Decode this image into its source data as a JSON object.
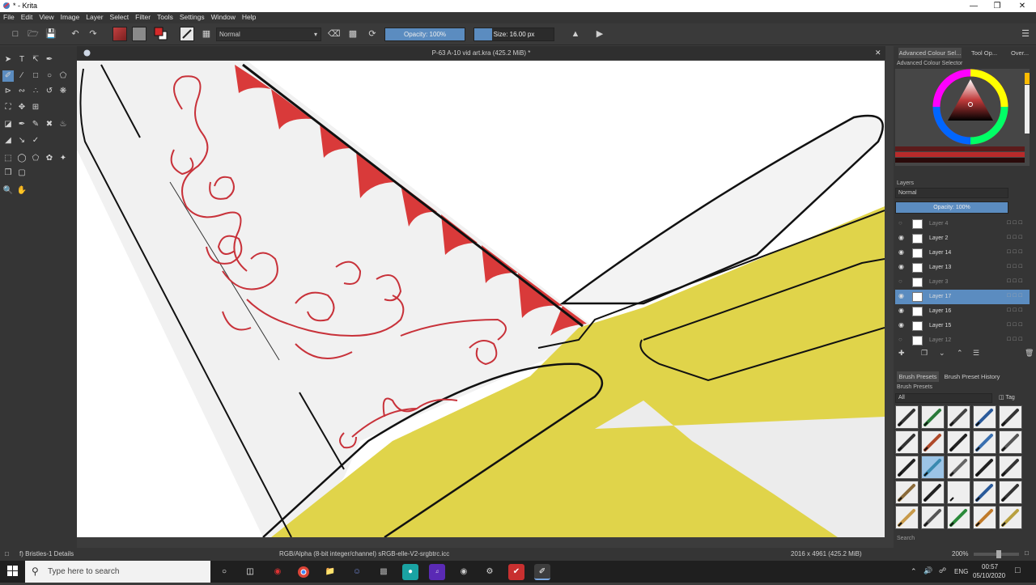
{
  "window": {
    "title": "* - Krita",
    "app_icon": "krita-icon",
    "controls": [
      "minimize-icon",
      "restore-icon",
      "close-icon"
    ]
  },
  "menu": [
    "File",
    "Edit",
    "View",
    "Image",
    "Layer",
    "Select",
    "Filter",
    "Tools",
    "Settings",
    "Window",
    "Help"
  ],
  "toolbar": {
    "blend_mode": "Normal",
    "opacity_label": "Opacity: 100%",
    "opacity_value": 1.0,
    "size_label": "Size: 16.00 px"
  },
  "document": {
    "tab_title": "P-63 A-10 vid art.kra (425.2 MiB) *"
  },
  "panels": {
    "tabs": [
      "Advanced Colour Sel...",
      "Tool Op...",
      "Over..."
    ],
    "color_selector_title": "Advanced Colour Selector",
    "layers_title": "Layers",
    "layers_blend": "Normal",
    "layers_opacity": "Opacity: 100%",
    "layers": [
      {
        "name": "Layer 4",
        "visible": false,
        "selected": false
      },
      {
        "name": "Layer 2",
        "visible": true,
        "selected": false
      },
      {
        "name": "Layer 14",
        "visible": true,
        "selected": false
      },
      {
        "name": "Layer 13",
        "visible": true,
        "selected": false
      },
      {
        "name": "Layer 3",
        "visible": false,
        "selected": false
      },
      {
        "name": "Layer 17",
        "visible": true,
        "selected": true
      },
      {
        "name": "Layer 16",
        "visible": true,
        "selected": false
      },
      {
        "name": "Layer 15",
        "visible": true,
        "selected": false
      },
      {
        "name": "Layer 12",
        "visible": false,
        "selected": false
      }
    ],
    "brush_tabs": [
      "Brush Presets",
      "Brush Preset History"
    ],
    "brush_presets_title": "Brush Presets",
    "brush_filter": "All",
    "brush_tag": "Tag",
    "brush_search": "Search"
  },
  "status": {
    "brush_details": "f) Bristles-1 Details",
    "color_profile": "RGB/Alpha (8-bit integer/channel)  sRGB-elle-V2-srgbtrc.icc",
    "image_size": "2016 x 4961 (425.2 MiB)",
    "zoom": "200%"
  },
  "taskbar": {
    "search_placeholder": "Type here to search",
    "language": "ENG",
    "time": "00:57",
    "date": "05/10/2020",
    "apps": [
      "cortana-icon",
      "task-view-icon",
      "obs-icon",
      "chrome-icon",
      "file-explorer-icon",
      "discord-icon",
      "app-icon",
      "app-icon",
      "amazon-music-icon",
      "app-icon",
      "steam-icon",
      "app-icon",
      "krita-taskbar-icon"
    ]
  },
  "colors": {
    "accent_blue": "#5b8cc0",
    "plane_yellow": "#e0d44a",
    "shark_red": "#d93a3a"
  }
}
